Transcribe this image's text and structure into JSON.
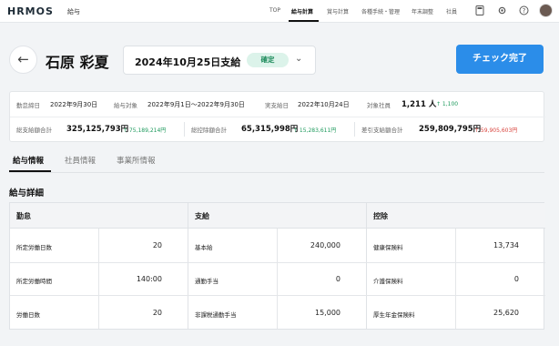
{
  "app": {
    "logo": "HRMOS",
    "module": "給与"
  },
  "nav": {
    "top": "TOP",
    "payroll": "給与計算",
    "bonus": "賞与計算",
    "procedures": "各種手続・管理",
    "year_end": "年末調整",
    "company": "社員"
  },
  "header": {
    "employee_name": "石原 彩夏",
    "pay_date": "2024年10月25日支給",
    "status": "確定",
    "check_done": "チェック完了"
  },
  "summary": {
    "closing_label": "勤怠締日",
    "closing_value": "2022年9月30日",
    "period_label": "給与対象",
    "period_value": "2022年9月1日〜2022年9月30日",
    "paid_label": "実支給日",
    "paid_value": "2022年10月24日",
    "employees_label": "対象社員",
    "employees_value": "1,211 人",
    "employees_change": "↑ 1,100",
    "gross_label": "総支給額合計",
    "gross_value": "325,125,793円",
    "gross_change": "↑ 75,189,214円",
    "deduction_label": "総控除額合計",
    "deduction_value": "65,315,998円",
    "deduction_change": "↑ 15,283,611円",
    "net_label": "差引支給額合計",
    "net_value": "259,809,795円",
    "net_change": "↑ 59,905,603円"
  },
  "tabs": {
    "salary": "給与情報",
    "employee": "社員情報",
    "office": "事業所情報"
  },
  "section": {
    "title": "給与詳細"
  },
  "table": {
    "attendance_header": "勤怠",
    "payment_header": "支給",
    "deduction_header": "控除",
    "rows": [
      {
        "a_label": "所定労働日数",
        "a_value": "20",
        "p_label": "基本給",
        "p_value": "240,000",
        "d_label": "健康保険料",
        "d_value": "13,734"
      },
      {
        "a_label": "所定労働時間",
        "a_value": "140:00",
        "p_label": "通勤手当",
        "p_value": "0",
        "d_label": "介護保険料",
        "d_value": "0"
      },
      {
        "a_label": "労働日数",
        "a_value": "20",
        "p_label": "非課税通勤手当",
        "p_value": "15,000",
        "d_label": "厚生年金保険料",
        "d_value": "25,620"
      }
    ]
  },
  "icons": {
    "back": "arrow-left-icon",
    "chevron": "chevron-down-icon",
    "calc": "calculator-icon",
    "settings": "gear-icon",
    "help": "help-icon"
  },
  "colors": {
    "accent": "#2b8de9",
    "confirmed": "#1b8a5a",
    "up": "#1e9a5d",
    "down": "#d9443d"
  }
}
